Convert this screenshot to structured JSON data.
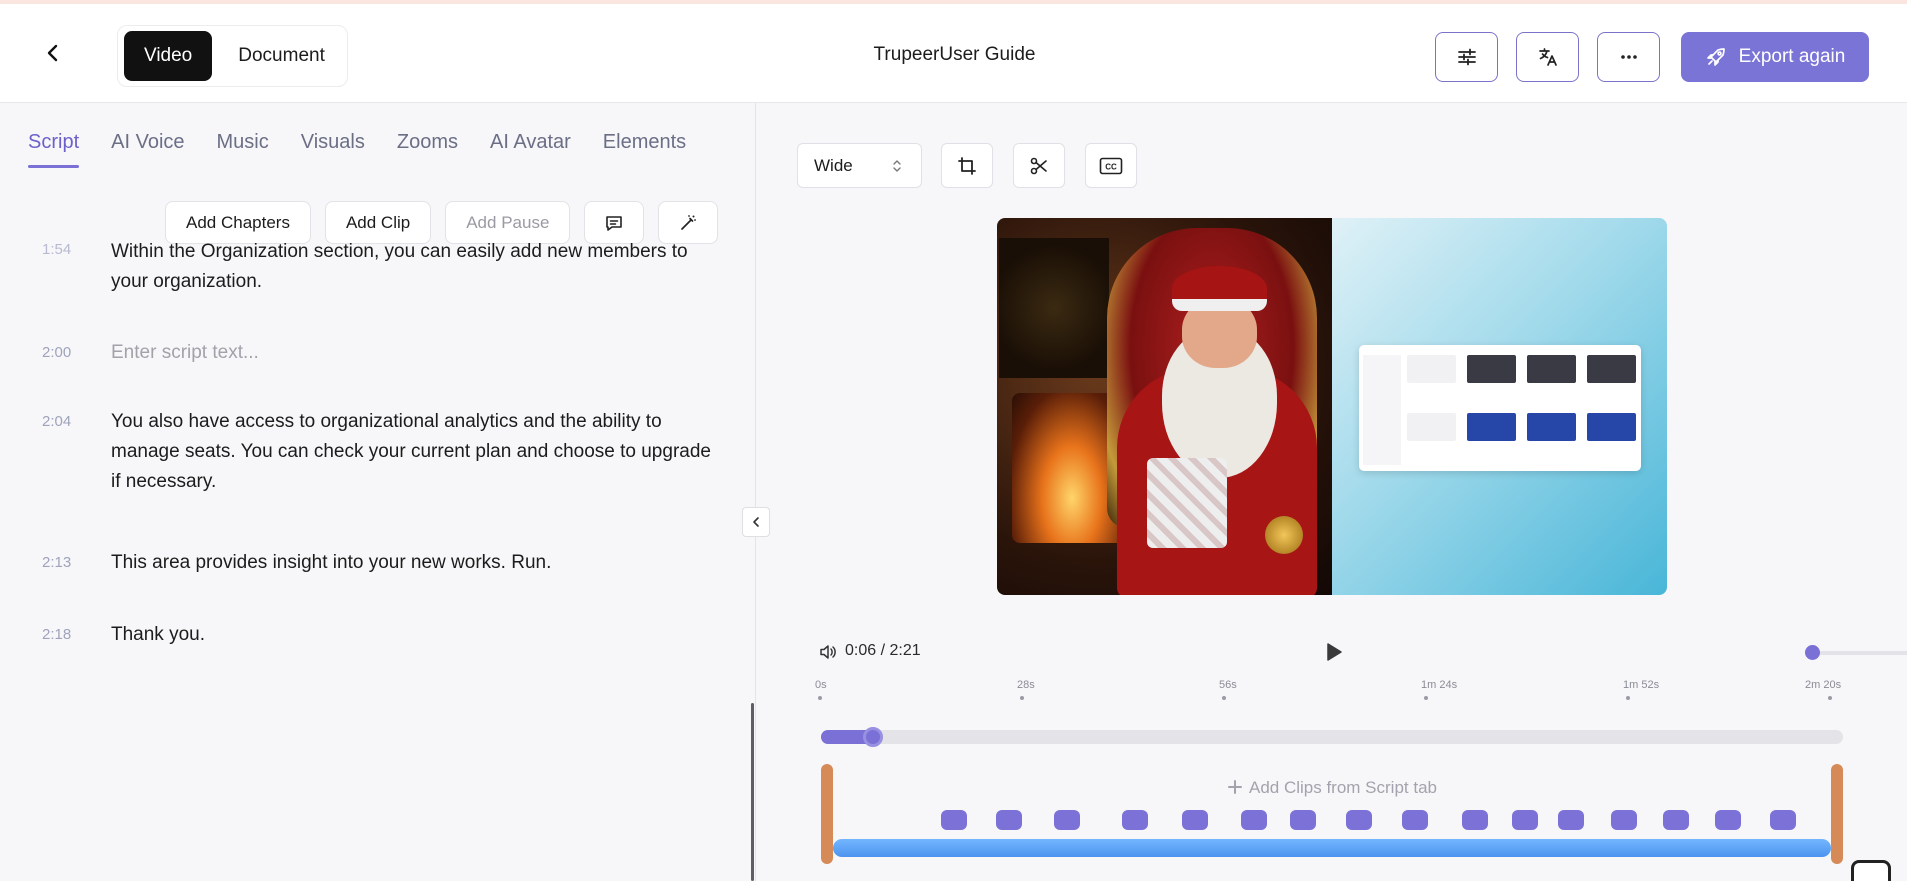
{
  "header": {
    "modes": [
      "Video",
      "Document"
    ],
    "active_mode": "Video",
    "title": "TrupeerUser Guide",
    "export_label": "Export again"
  },
  "left_panel": {
    "tabs": [
      "Script",
      "AI Voice",
      "Music",
      "Visuals",
      "Zooms",
      "AI Avatar",
      "Elements"
    ],
    "active_tab": "Script",
    "toolbar": {
      "add_chapters": "Add Chapters",
      "add_clip": "Add Clip",
      "add_pause": "Add Pause"
    },
    "segments": [
      {
        "time": "1:54",
        "text": "Within the Organization section, you can easily add new members to your organization."
      },
      {
        "time": "2:00",
        "text": "Enter script text...",
        "placeholder": true
      },
      {
        "time": "2:04",
        "text": "You also have access to organizational analytics and the ability to manage seats. You can check your current plan and choose to upgrade if necessary."
      },
      {
        "time": "2:13",
        "text": "This area provides insight into your new works. Run."
      },
      {
        "time": "2:18",
        "text": "Thank you."
      }
    ]
  },
  "right_panel": {
    "aspect_select": "Wide",
    "player": {
      "current_time": "0:06",
      "separator": "/",
      "duration": "2:21",
      "progress_fraction": 0.043,
      "volume_fraction": 0.0
    },
    "ruler": [
      "0s",
      "28s",
      "56s",
      "1m 24s",
      "1m 52s",
      "2m 20s"
    ],
    "timeline": {
      "add_clips_label": "Add Clips from Script tab",
      "clip_count": 17
    }
  },
  "colors": {
    "accent": "#7a70d6",
    "export_bg": "#7a74d6",
    "track_bar": "#4b93ee",
    "track_edge": "#d68a57"
  }
}
